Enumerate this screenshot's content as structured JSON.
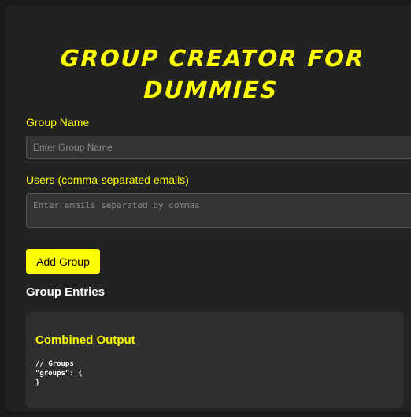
{
  "app": {
    "title_line1": "GROUP CREATOR FOR",
    "title_line2": "DUMMIES"
  },
  "form": {
    "group_name_label": "Group Name",
    "group_name_placeholder": "Enter Group Name",
    "group_name_value": "",
    "users_label": "Users (comma-separated emails)",
    "users_placeholder": "Enter emails separated by commas",
    "users_value": "",
    "add_button_label": "Add Group"
  },
  "entries": {
    "title": "Group Entries"
  },
  "output": {
    "title": "Combined Output",
    "code": "// Groups\n\"groups\": {\n}"
  },
  "colors": {
    "accent": "#ffff00",
    "background": "#222222",
    "panel": "#2f2f2f",
    "input_bg": "#333333"
  }
}
